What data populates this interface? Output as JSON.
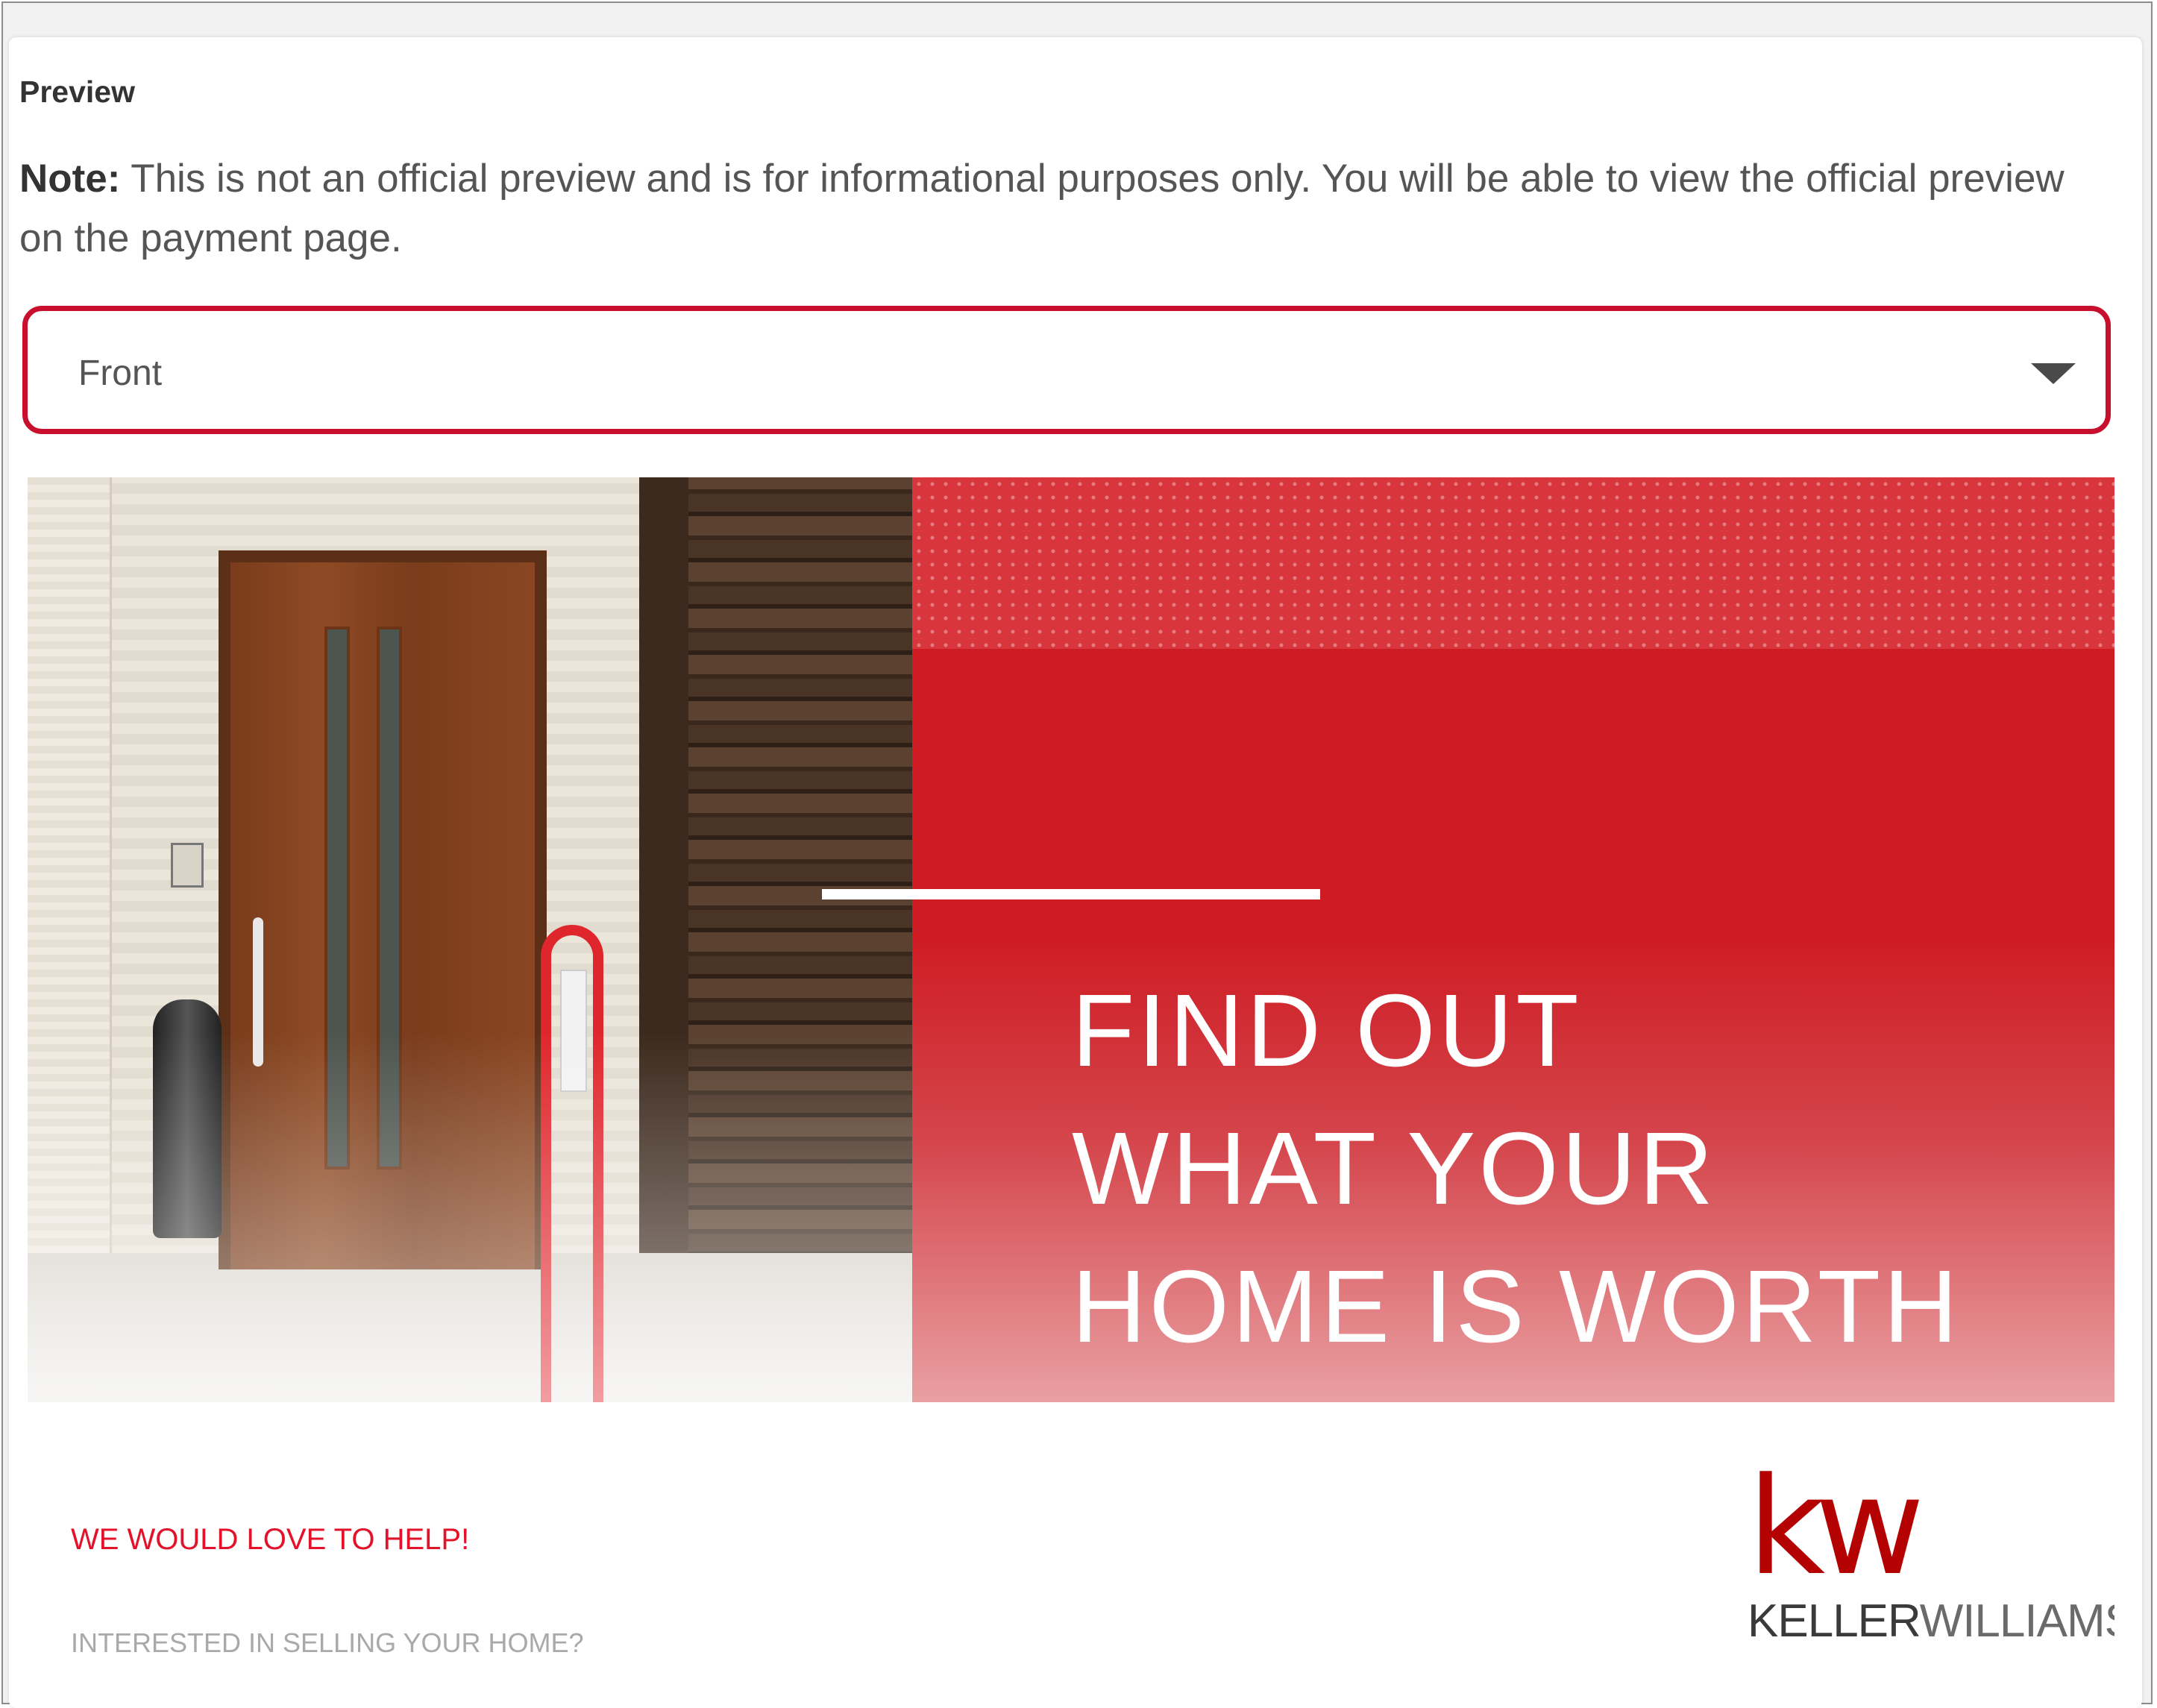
{
  "preview": {
    "section_label": "Preview",
    "note_label": "Note:",
    "note_text": " This is not an official preview and is for informational purposes only. You will be able to view the official preview on the payment page."
  },
  "side_select": {
    "selected": "Front"
  },
  "postcard": {
    "headline": [
      "FIND OUT",
      "WHAT YOUR",
      "HOME IS WORTH"
    ],
    "tagline": "WE WOULD LOVE TO HELP!",
    "subtext": "INTERESTED IN SELLING YOUR HOME?",
    "logo_mark": "kw",
    "logo_word_1": "KELLER",
    "logo_word_2": "WILLIAMS"
  },
  "colors": {
    "accent_red": "#c8102e",
    "card_red": "#cf1c24",
    "logo_red": "#b40101"
  }
}
